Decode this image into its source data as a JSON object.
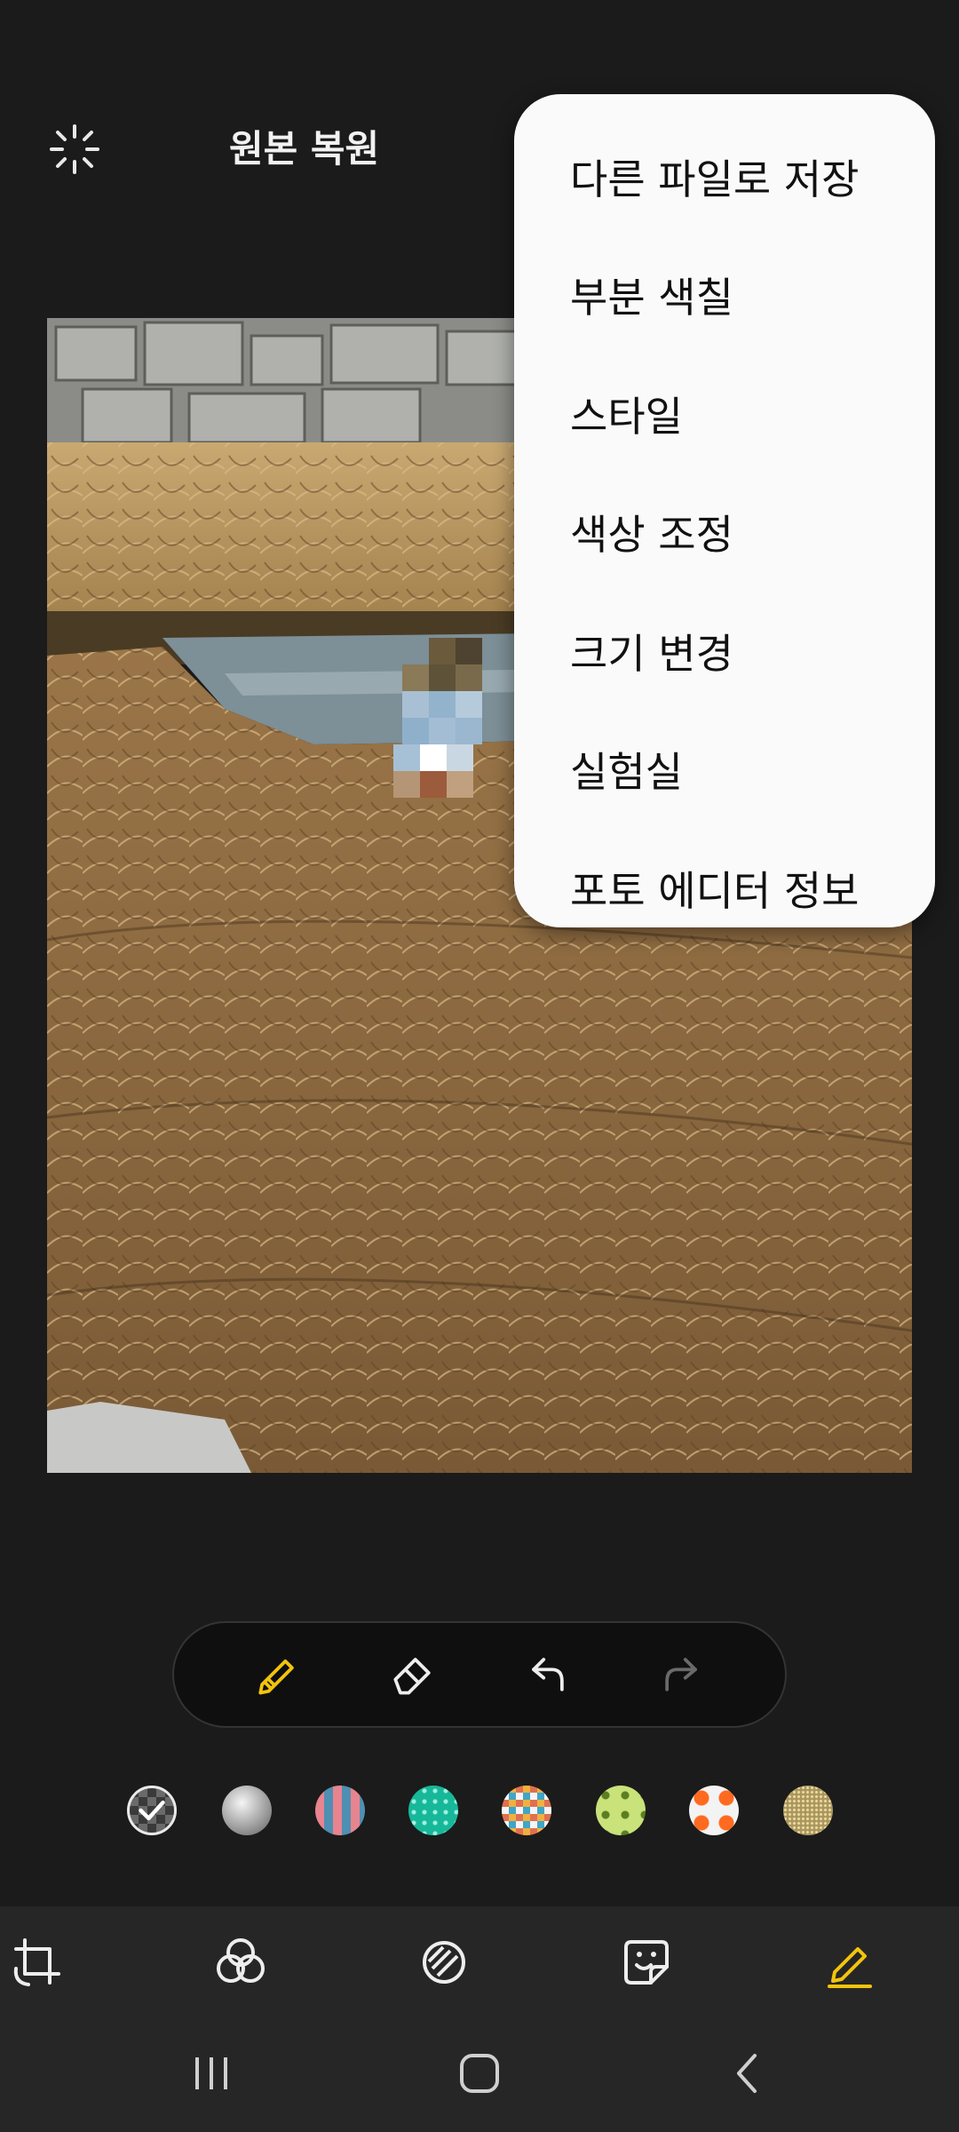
{
  "header": {
    "restore_label": "원본 복원",
    "auto_icon": "auto-enhance-icon"
  },
  "menu": {
    "items": [
      {
        "label": "다른 파일로 저장"
      },
      {
        "label": "부분 색칠"
      },
      {
        "label": "스타일"
      },
      {
        "label": "색상 조정"
      },
      {
        "label": "크기 변경"
      },
      {
        "label": "실험실"
      },
      {
        "label": "포토 에디터 정보"
      }
    ]
  },
  "pen_toolbar": {
    "tools": [
      "pen-icon",
      "eraser-icon",
      "undo-icon",
      "redo-icon"
    ],
    "active_color": "#f2c40d",
    "disabled_color": "#6a6a6a"
  },
  "swatches": [
    "selected-pattern",
    "silver-gradient",
    "pink-blue-stripes",
    "teal-dots",
    "triangles-pattern",
    "avocado-pattern",
    "orange-pattern",
    "gold-glitter"
  ],
  "bottom_tabs": [
    "crop-rotate-icon",
    "filters-icon",
    "tone-icon",
    "sticker-icon",
    "draw-icon"
  ],
  "nav_buttons": [
    "recent-apps-icon",
    "home-icon",
    "back-icon"
  ]
}
